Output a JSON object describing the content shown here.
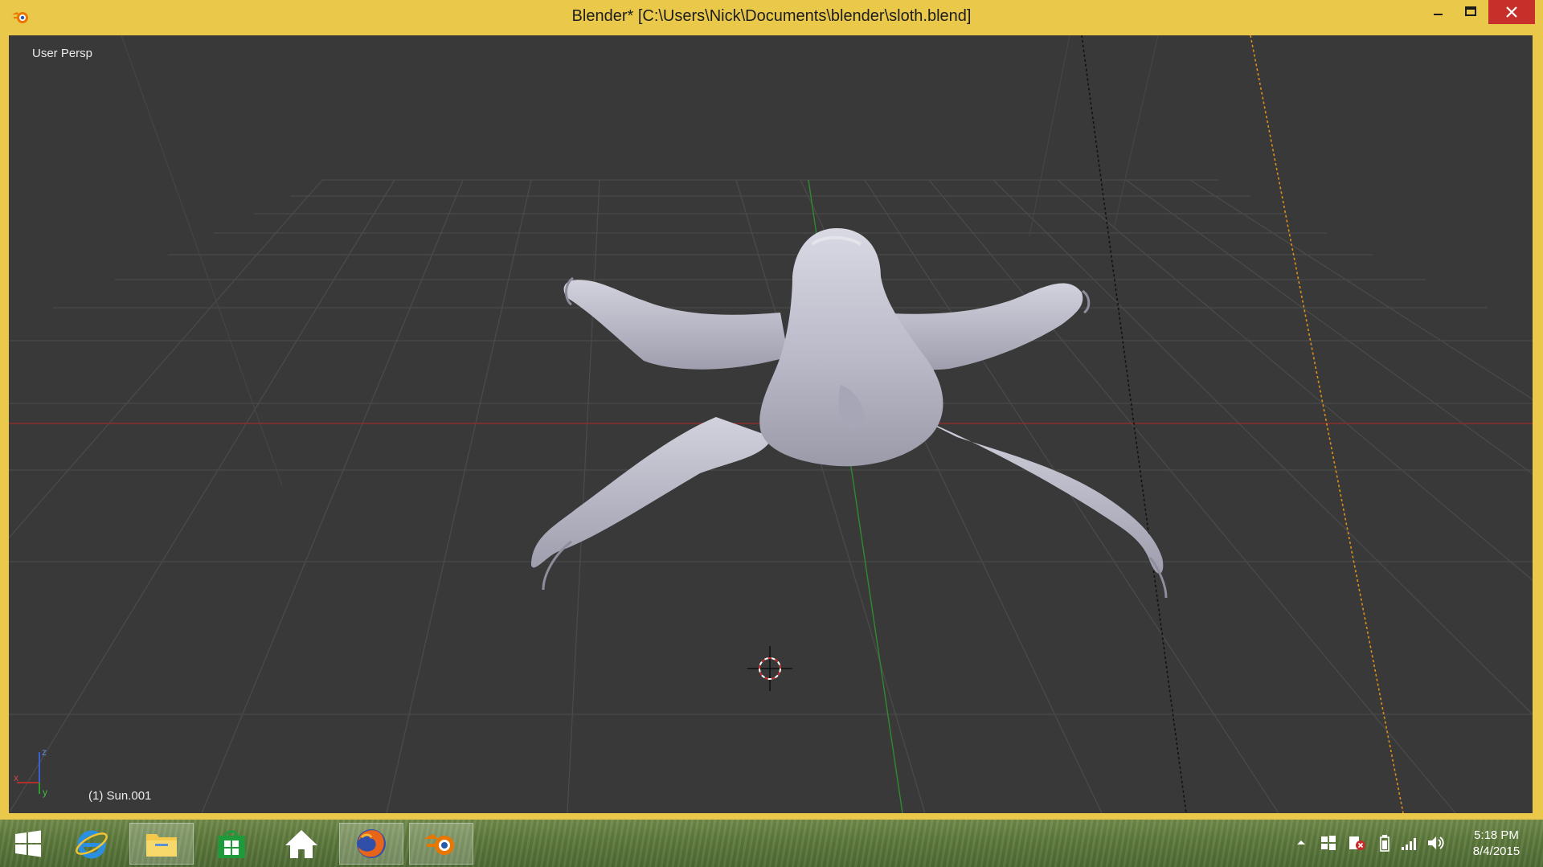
{
  "window": {
    "title": "Blender* [C:\\Users\\Nick\\Documents\\blender\\sloth.blend]",
    "app_icon": "blender-icon",
    "controls": [
      "minimize-icon",
      "maximize-icon",
      "close-icon"
    ],
    "frame_color": "#e9c84a"
  },
  "viewport": {
    "view_label": "User Persp",
    "object_label": "(1) Sun.001",
    "background_color": "#393939",
    "grid": true,
    "axis_colors": {
      "x": "#b03030",
      "y": "#2e9b2e",
      "z": "#3a5fd0"
    },
    "gizmo_labels": {
      "x": "x",
      "y": "y",
      "z": "z"
    },
    "model": "sloth"
  },
  "taskbar": {
    "items": [
      {
        "name": "start-button",
        "icon": "windows-logo-icon"
      },
      {
        "name": "internet-explorer",
        "icon": "ie-icon"
      },
      {
        "name": "file-explorer",
        "icon": "folder-icon"
      },
      {
        "name": "windows-store",
        "icon": "store-icon"
      },
      {
        "name": "home",
        "icon": "home-icon"
      },
      {
        "name": "firefox",
        "icon": "firefox-icon"
      },
      {
        "name": "blender",
        "icon": "blender-icon",
        "active": true
      }
    ],
    "tray_icons": [
      "show-hidden-icons-chevron",
      "windows-flag-icon",
      "action-center-icon",
      "battery-icon",
      "network-signal-icon",
      "volume-icon"
    ],
    "clock": {
      "time": "5:18 PM",
      "date": "8/4/2015"
    }
  }
}
